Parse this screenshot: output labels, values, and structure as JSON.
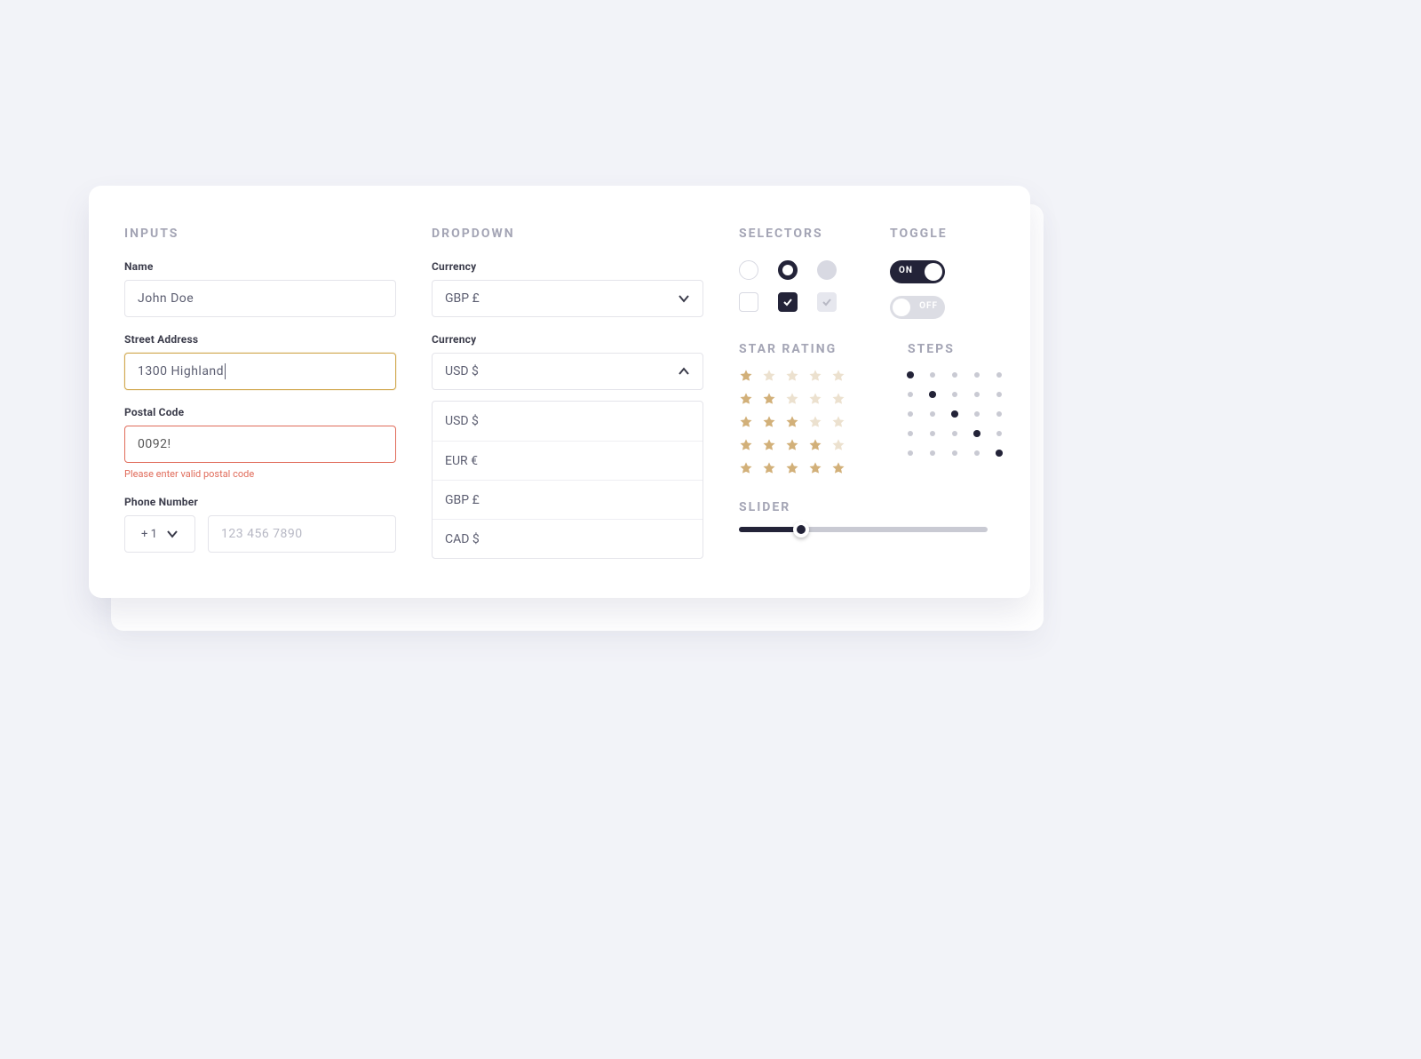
{
  "colors": {
    "gold": "#d2b079",
    "gold_dim": "#ece1cf",
    "dark": "#232338"
  },
  "inputs": {
    "title": "INPUTS",
    "name_label": "Name",
    "name_value": "John Doe",
    "street_label": "Street Address",
    "street_value": "1300 Highland",
    "postal_label": "Postal Code",
    "postal_value": "0092!",
    "postal_error": "Please enter valid postal code",
    "phone_label": "Phone Number",
    "phone_code": "+ 1",
    "phone_placeholder": "123 456 7890"
  },
  "dropdown": {
    "title": "DROPDOWN",
    "closed": {
      "label": "Currency",
      "value": "GBP £"
    },
    "open": {
      "label": "Currency",
      "value": "USD $",
      "options": [
        "USD $",
        "EUR €",
        "GBP £",
        "CAD $"
      ]
    }
  },
  "selectors": {
    "title": "SELECTORS"
  },
  "toggle": {
    "title": "TOGGLE",
    "on_label": "ON",
    "off_label": "OFF"
  },
  "star_rating": {
    "title": "STAR RATING",
    "rows": [
      1,
      2,
      3,
      4,
      5
    ],
    "max": 5
  },
  "steps": {
    "title": "STEPS",
    "rows": [
      1,
      2,
      3,
      4,
      5
    ],
    "max": 5
  },
  "slider": {
    "title": "SLIDER",
    "percent": 25
  }
}
